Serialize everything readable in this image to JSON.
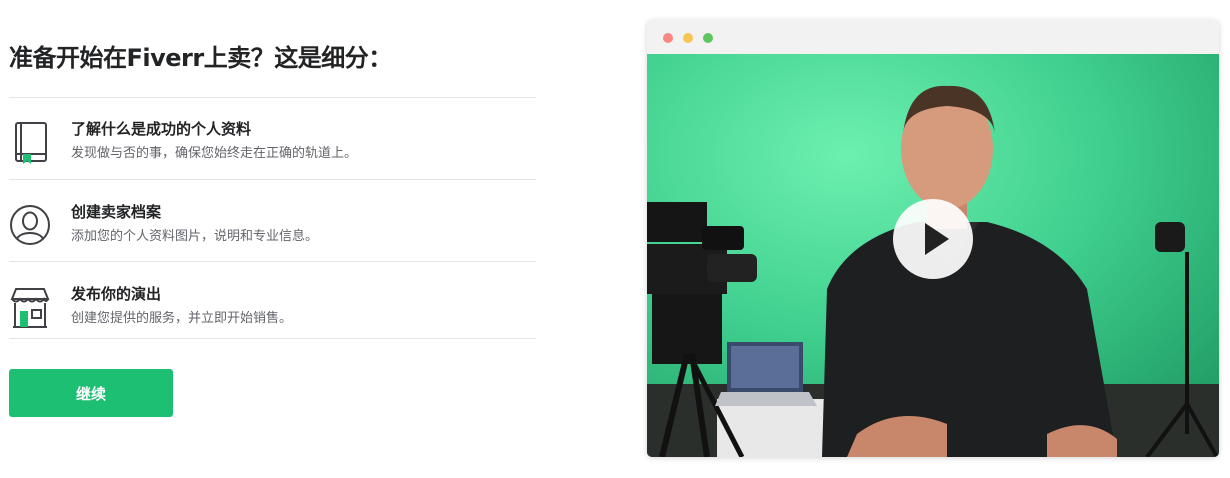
{
  "heading": "准备开始在Fiverr上卖？这是细分：",
  "steps": [
    {
      "title": "了解什么是成功的个人资料",
      "desc": "发现做与否的事，确保您始终走在正确的轨道上。",
      "icon": "book-icon"
    },
    {
      "title": "创建卖家档案",
      "desc": "添加您的个人资料图片，说明和专业信息。",
      "icon": "user-profile-icon"
    },
    {
      "title": "发布你的演出",
      "desc": "创建您提供的服务，并立即开始销售。",
      "icon": "storefront-icon"
    }
  ],
  "continue_label": "继续",
  "colors": {
    "accent": "#1dbf73",
    "icon_green": "#1dbf73",
    "icon_dark": "#404145",
    "dot_red": "#f78884",
    "dot_yellow": "#f6c555",
    "dot_green": "#5fc55f",
    "greenscreen": "#3fcf8e"
  }
}
